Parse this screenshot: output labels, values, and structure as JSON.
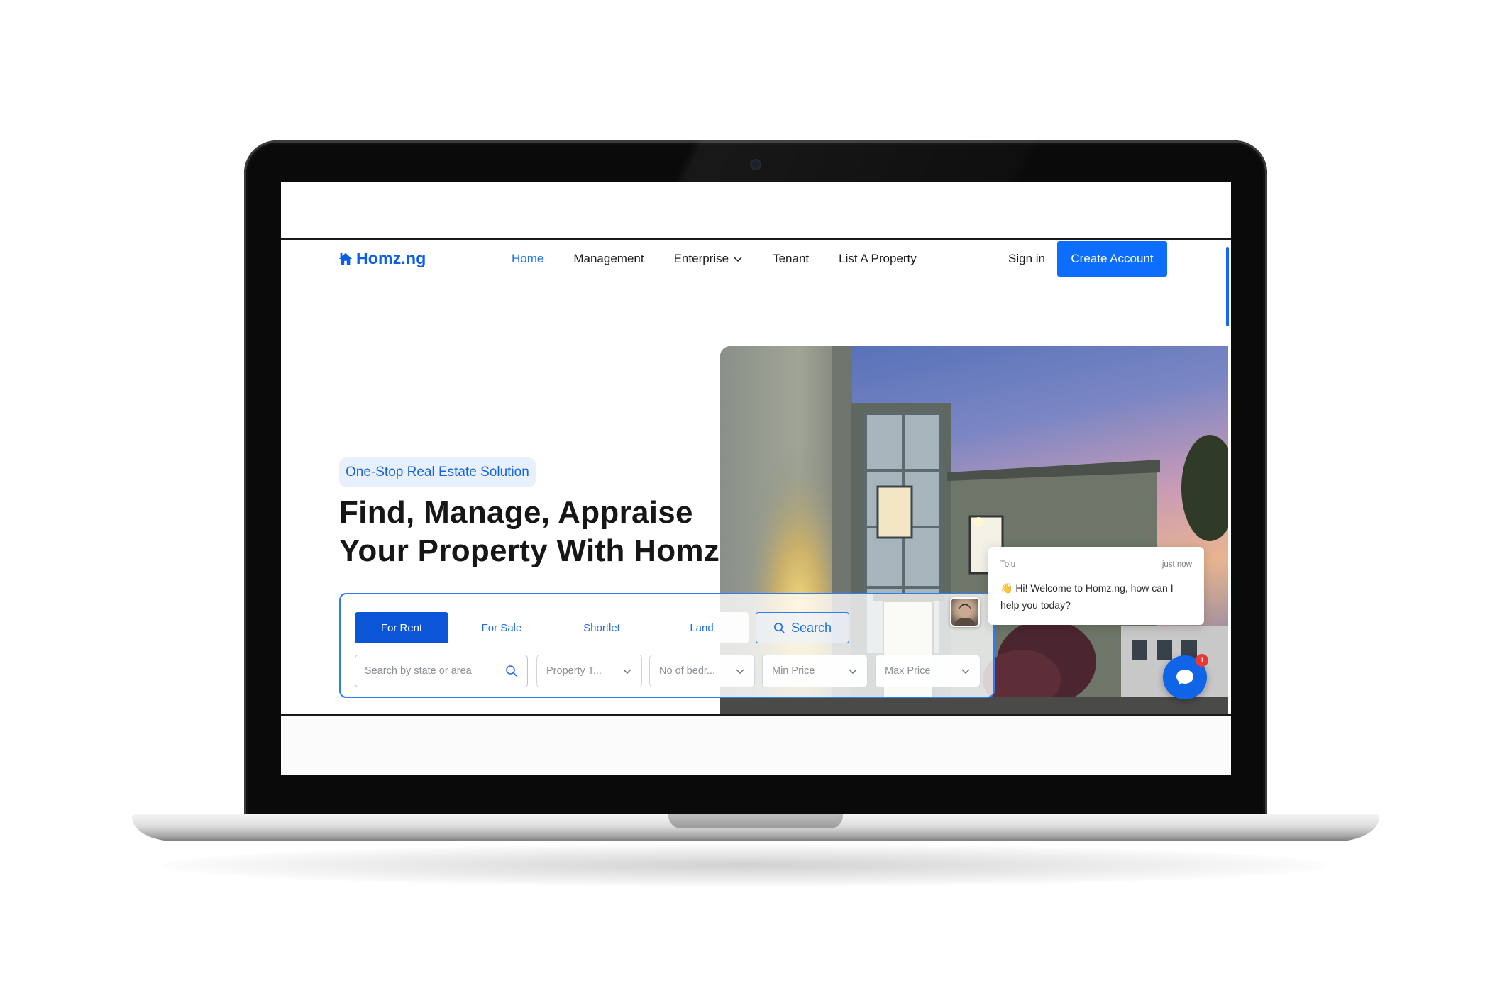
{
  "nav": {
    "logo_text": "Homz.ng",
    "items": [
      {
        "label": "Home",
        "active": true
      },
      {
        "label": "Management"
      },
      {
        "label": "Enterprise",
        "dropdown": true
      },
      {
        "label": "Tenant"
      },
      {
        "label": "List A Property"
      }
    ],
    "sign_in": "Sign in",
    "create_account": "Create Account"
  },
  "hero": {
    "tagline": "One-Stop Real Estate Solution",
    "headline_line1": "Find, Manage, Appraise",
    "headline_line2": "Your Property With Homz"
  },
  "search": {
    "tabs": [
      "For Rent",
      "For Sale",
      "Shortlet",
      "Land"
    ],
    "active_tab": "For Rent",
    "search_button": "Search",
    "location_placeholder": "Search by state or area",
    "property_type": "Property T...",
    "bedrooms": "No of bedr...",
    "min_price": "Min Price",
    "max_price": "Max Price"
  },
  "chat": {
    "agent_name": "Tolu",
    "time": "just now",
    "message": "👋 Hi! Welcome to Homz.ng, how can I help you today?",
    "unread_count": "1"
  },
  "colors": {
    "brand_blue": "#0d6efd",
    "active_tab": "#0a56d6",
    "tagline_bg": "#e8f0fe"
  }
}
